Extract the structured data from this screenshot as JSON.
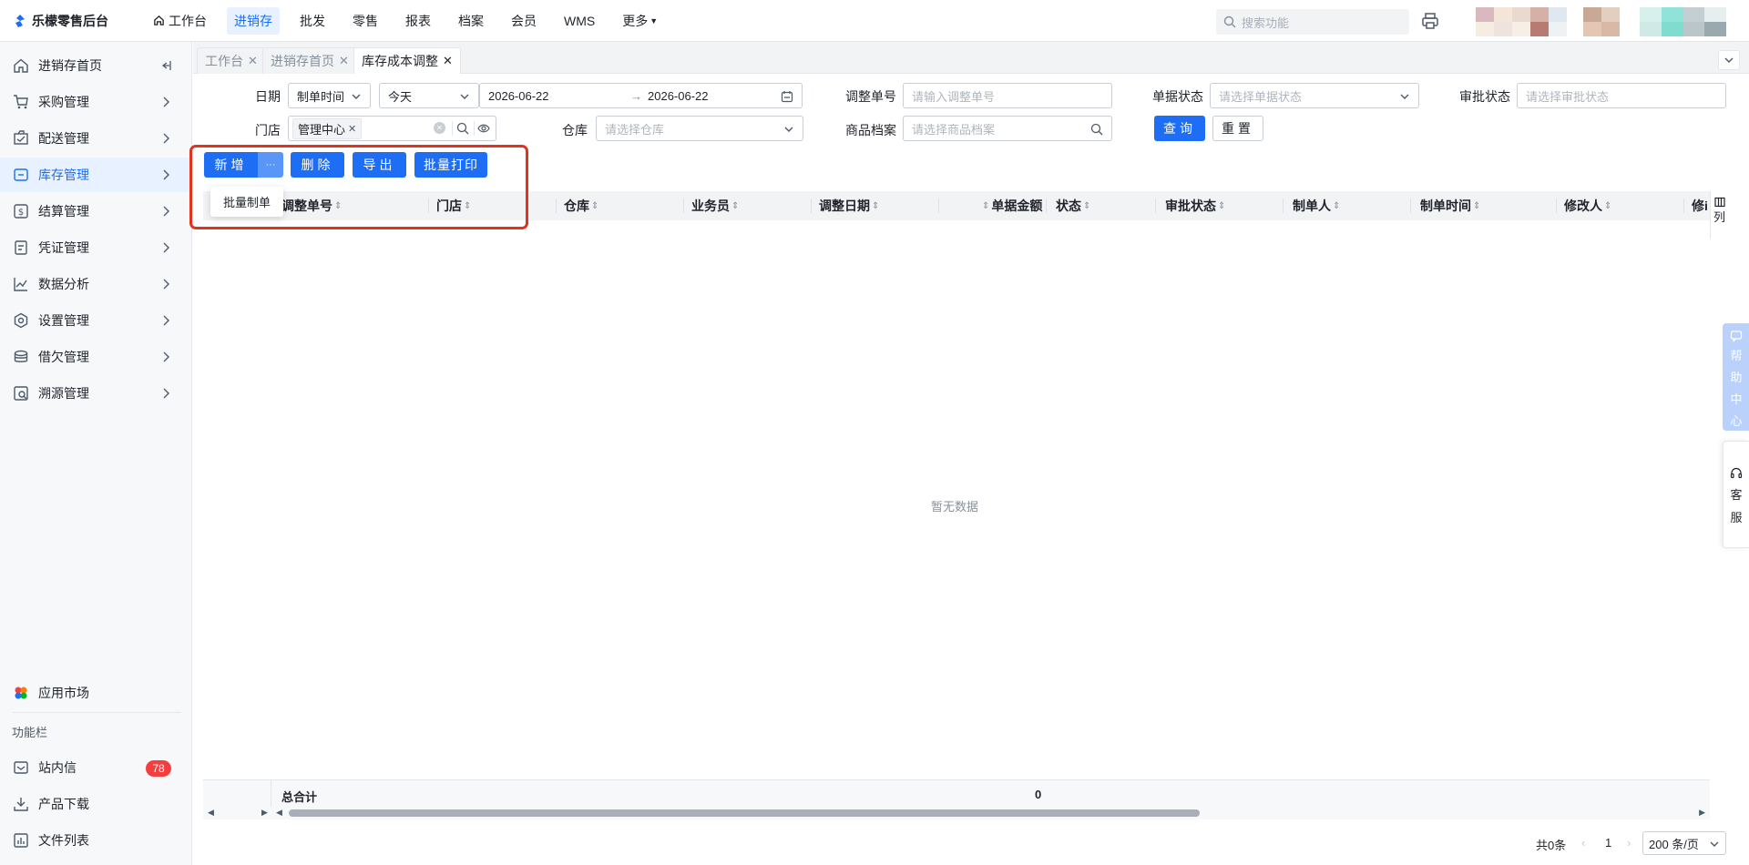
{
  "app": {
    "title": "乐檬零售后台"
  },
  "nav": [
    {
      "label": "工作台",
      "icon": "home-icon"
    },
    {
      "label": "进销存"
    },
    {
      "label": "批发"
    },
    {
      "label": "零售"
    },
    {
      "label": "报表"
    },
    {
      "label": "档案"
    },
    {
      "label": "会员"
    },
    {
      "label": "WMS"
    },
    {
      "label": "更多"
    }
  ],
  "search": {
    "placeholder": "搜索功能"
  },
  "sidebar": {
    "items": [
      {
        "label": "进销存首页",
        "icon": "home-icon"
      },
      {
        "label": "采购管理",
        "icon": "cart-icon"
      },
      {
        "label": "配送管理",
        "icon": "delivery-icon"
      },
      {
        "label": "库存管理",
        "icon": "inventory-icon"
      },
      {
        "label": "结算管理",
        "icon": "settlement-icon"
      },
      {
        "label": "凭证管理",
        "icon": "voucher-icon"
      },
      {
        "label": "数据分析",
        "icon": "chart-icon"
      },
      {
        "label": "设置管理",
        "icon": "settings-icon"
      },
      {
        "label": "借欠管理",
        "icon": "coins-icon"
      },
      {
        "label": "溯源管理",
        "icon": "trace-icon"
      }
    ],
    "app_market": "应用市场",
    "section_title": "功能栏",
    "footer": [
      {
        "label": "站内信",
        "badge": "78"
      },
      {
        "label": "产品下载"
      },
      {
        "label": "文件列表"
      }
    ]
  },
  "tabs": [
    {
      "label": "工作台"
    },
    {
      "label": "进销存首页"
    },
    {
      "label": "库存成本调整"
    }
  ],
  "filters": {
    "date_label": "日期",
    "date_type": "制单时间",
    "date_range": "今天",
    "date_start": "2026-06-22",
    "date_end": "2026-06-22",
    "adjust_no_label": "调整单号",
    "adjust_no_placeholder": "请输入调整单号",
    "doc_status_label": "单据状态",
    "doc_status_placeholder": "请选择单据状态",
    "approval_label": "审批状态",
    "approval_placeholder": "请选择审批状态",
    "store_label": "门店",
    "store_value": "管理中心",
    "warehouse_label": "仓库",
    "warehouse_placeholder": "请选择仓库",
    "product_label": "商品档案",
    "product_placeholder": "请选择商品档案",
    "query": "查询",
    "reset": "重置"
  },
  "toolbar": {
    "add": "新增",
    "more": "···",
    "delete": "删除",
    "export": "导出",
    "batch_print": "批量打印",
    "dropdown_item": "批量制单"
  },
  "table": {
    "columns": [
      "调整单号",
      "门店",
      "仓库",
      "业务员",
      "调整日期",
      "单据金额",
      "状态",
      "审批状态",
      "制单人",
      "制单时间",
      "修改人",
      "修i"
    ],
    "empty": "暂无数据",
    "total_label": "总合计",
    "total_value": "0",
    "col_setting": "列"
  },
  "pagination": {
    "total": "共0条",
    "page": "1",
    "page_size": "200 条/页"
  },
  "float": {
    "help": [
      "帮",
      "助",
      "中",
      "心"
    ],
    "service": [
      "客",
      "服"
    ]
  },
  "colors": {
    "primary": "#1d6ef5",
    "highlight": "#e0341e",
    "badge": "#f53f3f"
  }
}
